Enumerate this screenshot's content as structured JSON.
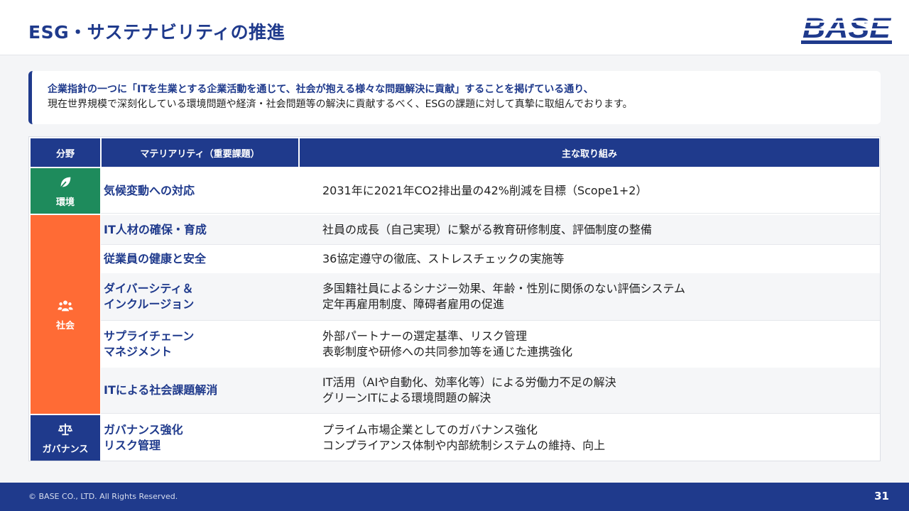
{
  "header": {
    "title": "ESG・サステナビリティの推進",
    "logo_text": "BASE"
  },
  "intro": {
    "line1": "企業指針の一つに「ITを生業とする企業活動を通じて、社会が抱える様々な問題解決に貢献」することを掲げている通り、",
    "line2": "現在世界規模で深刻化している環境問題や経済・社会問題等の解決に貢献するべく、ESGの課題に対して真摯に取組んでおります。"
  },
  "table": {
    "headers": {
      "field": "分野",
      "materiality": "マテリアリティ（重要課題）",
      "actions": "主な取り組み"
    },
    "categories": [
      {
        "label": "環境",
        "icon": "leaf-icon",
        "color": "#1e8b5c"
      },
      {
        "label": "社会",
        "icon": "people-icon",
        "color": "#ff6b35"
      },
      {
        "label": "ガバナンス",
        "icon": "scale-icon",
        "color": "#1f3a8c"
      }
    ],
    "rows": [
      {
        "materiality": [
          "気候変動への対応"
        ],
        "actions": [
          "2031年に2021年CO2排出量の42%削減を目標（Scope1+2）"
        ]
      },
      {
        "materiality": [
          "IT人材の確保・育成"
        ],
        "actions": [
          "社員の成長（自己実現）に繋がる教育研修制度、評価制度の整備"
        ]
      },
      {
        "materiality": [
          "従業員の健康と安全"
        ],
        "actions": [
          "36協定遵守の徹底、ストレスチェックの実施等"
        ]
      },
      {
        "materiality": [
          "ダイバーシティ＆",
          "インクルージョン"
        ],
        "actions": [
          "多国籍社員によるシナジー効果、年齢・性別に関係のない評価システム",
          "定年再雇用制度、障碍者雇用の促進"
        ]
      },
      {
        "materiality": [
          "サプライチェーン",
          "マネジメント"
        ],
        "actions": [
          "外部パートナーの選定基準、リスク管理",
          "表彰制度や研修への共同参加等を通じた連携強化"
        ]
      },
      {
        "materiality": [
          "ITによる社会課題解消"
        ],
        "actions": [
          "IT活用（AIや自動化、効率化等）による労働力不足の解決",
          "グリーンITによる環境問題の解決"
        ]
      },
      {
        "materiality": [
          "ガバナンス強化",
          "リスク管理"
        ],
        "actions": [
          "プライム市場企業としてのガバナンス強化",
          "コンプライアンス体制や内部統制システムの維持、向上"
        ]
      }
    ]
  },
  "footer": {
    "copyright": "© BASE CO., LTD. All Rights Reserved.",
    "page_number": "31"
  },
  "colors": {
    "brand": "#1f3a8c",
    "environment": "#1e8b5c",
    "social": "#ff6b35"
  }
}
